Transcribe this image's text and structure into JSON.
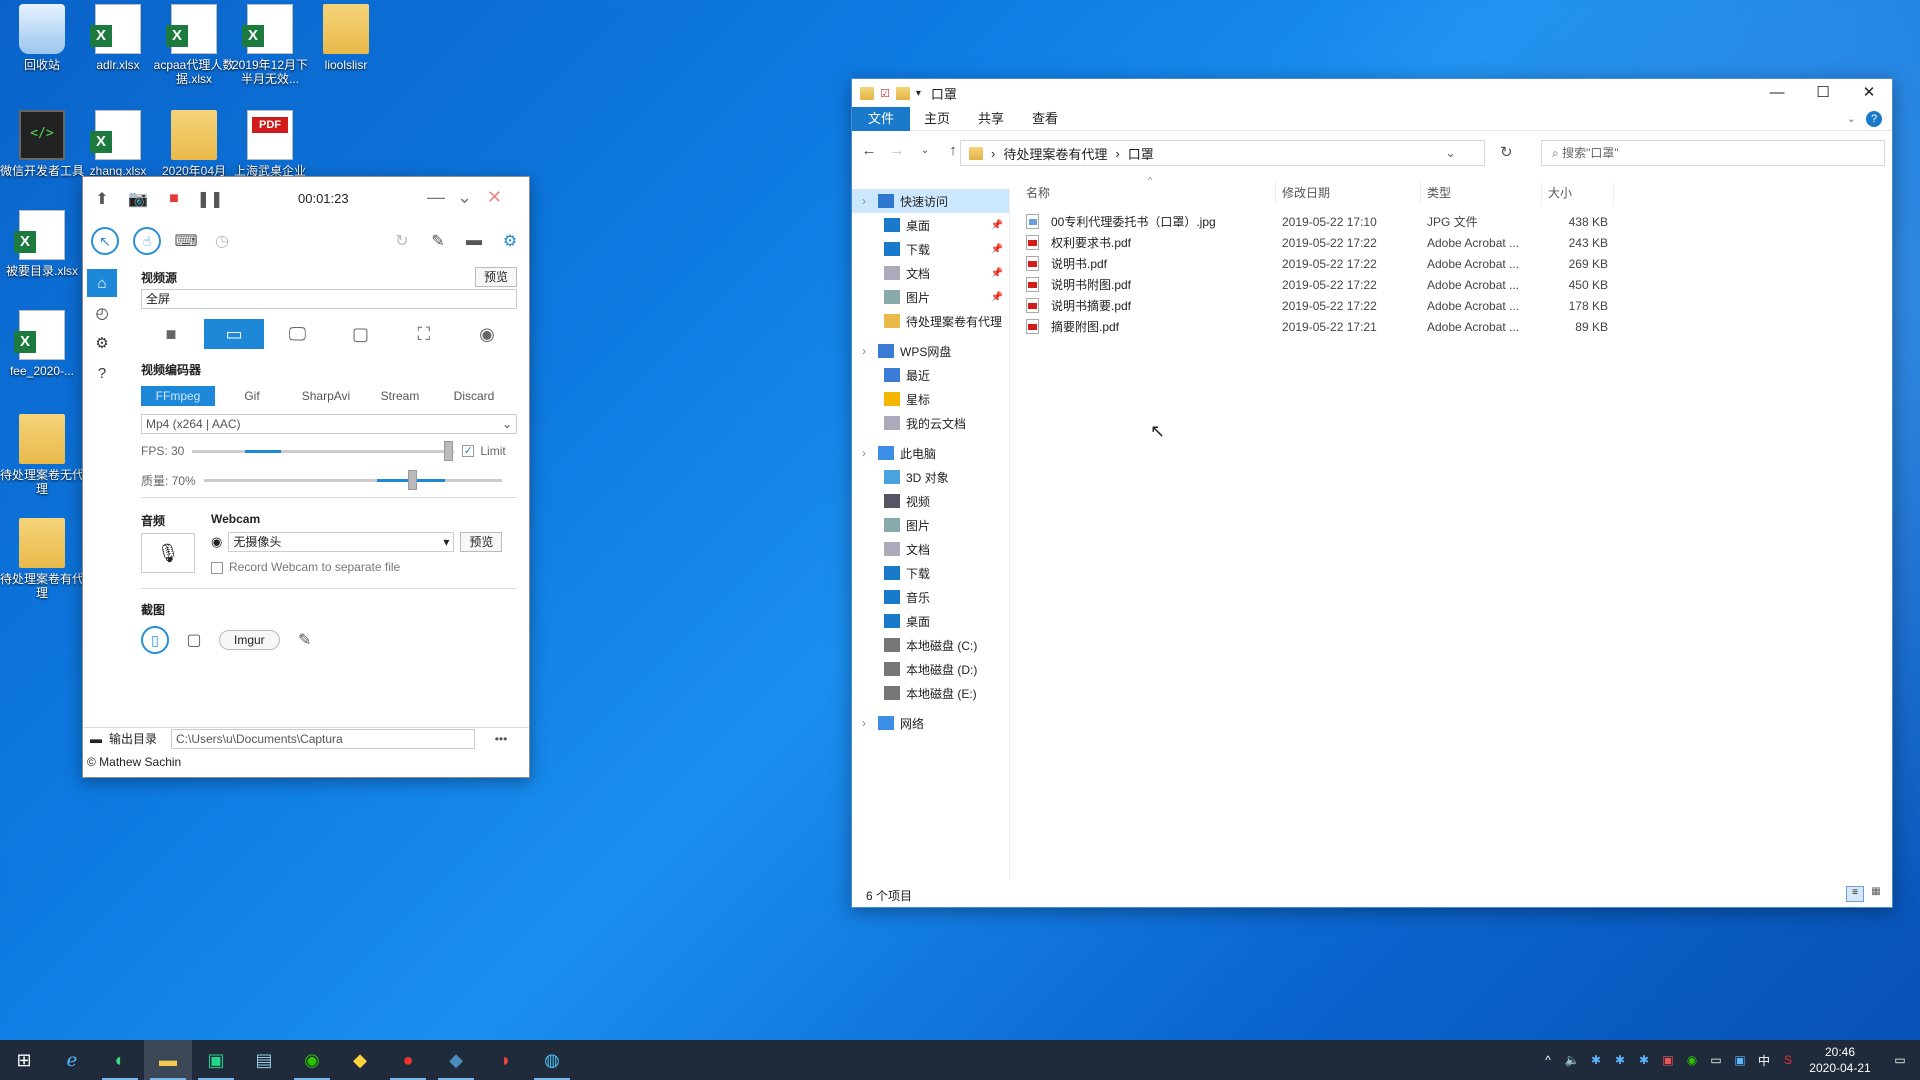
{
  "desktop": {
    "icons": [
      {
        "label": "回收站",
        "type": "recycle-bin"
      },
      {
        "label": "adlr.xlsx",
        "type": "excel"
      },
      {
        "label": "acpaa代理人数据.xlsx",
        "type": "excel"
      },
      {
        "label": "2019年12月下半月无效...",
        "type": "excel"
      },
      {
        "label": "lioolslisr",
        "type": "folder"
      },
      {
        "label": "微信开发者工具",
        "type": "terminal"
      },
      {
        "label": "zhang.xlsx",
        "type": "excel"
      },
      {
        "label": "2020年04月",
        "type": "folder"
      },
      {
        "label": "上海武桌企业",
        "type": "pdf"
      },
      {
        "label": "被要目录.xlsx",
        "type": "excel"
      },
      {
        "label": "fee_2020-...",
        "type": "excel"
      },
      {
        "label": "待处理案卷无代理",
        "type": "folder"
      },
      {
        "label": "待处理案卷有代理",
        "type": "folder"
      }
    ]
  },
  "captura": {
    "timer": "00:01:23",
    "video_source_label": "视频源",
    "preview_label": "预览",
    "source_value": "全屏",
    "encoder_label": "视频编码器",
    "encoders": [
      "FFmpeg",
      "Gif",
      "SharpAvi",
      "Stream",
      "Discard"
    ],
    "encoder_selected": "FFmpeg",
    "format": "Mp4 (x264 | AAC)",
    "fps_label": "FPS: 30",
    "fps_value": 30,
    "limit_label": "Limit",
    "limit_checked": true,
    "quality_label": "质量: 70%",
    "quality_value": 70,
    "audio_label": "音频",
    "webcam_label": "Webcam",
    "webcam_value": "无摄像头",
    "webcam_preview": "预览",
    "webcam_separate": "Record Webcam to separate file",
    "screenshot_label": "截图",
    "imgur_label": "Imgur",
    "output_label": "输出目录",
    "output_path": "C:\\Users\\u\\Documents\\Captura",
    "more_label": "•••",
    "credit": "© Mathew Sachin",
    "accent": "#1e88d8"
  },
  "explorer": {
    "title": "口罩",
    "ribbon_tabs": [
      "文件",
      "主页",
      "共享",
      "查看"
    ],
    "breadcrumb": [
      "待处理案卷有代理",
      "口罩"
    ],
    "search_placeholder": "搜索\"口罩\"",
    "columns": [
      "名称",
      "修改日期",
      "类型",
      "大小"
    ],
    "files": [
      {
        "name": "00专利代理委托书（口罩）.jpg",
        "date": "2019-05-22 17:10",
        "type": "JPG 文件",
        "size": "438 KB",
        "kind": "jpg"
      },
      {
        "name": "权利要求书.pdf",
        "date": "2019-05-22 17:22",
        "type": "Adobe Acrobat ...",
        "size": "243 KB",
        "kind": "pdf"
      },
      {
        "name": "说明书.pdf",
        "date": "2019-05-22 17:22",
        "type": "Adobe Acrobat ...",
        "size": "269 KB",
        "kind": "pdf"
      },
      {
        "name": "说明书附图.pdf",
        "date": "2019-05-22 17:22",
        "type": "Adobe Acrobat ...",
        "size": "450 KB",
        "kind": "pdf"
      },
      {
        "name": "说明书摘要.pdf",
        "date": "2019-05-22 17:22",
        "type": "Adobe Acrobat ...",
        "size": "178 KB",
        "kind": "pdf"
      },
      {
        "name": "摘要附图.pdf",
        "date": "2019-05-22 17:21",
        "type": "Adobe Acrobat ...",
        "size": "89 KB",
        "kind": "pdf"
      }
    ],
    "nav": [
      {
        "label": "快速访问",
        "level": 0,
        "icon": "star",
        "selected": true
      },
      {
        "label": "桌面",
        "level": 1,
        "icon": "desktop",
        "pinned": true
      },
      {
        "label": "下载",
        "level": 1,
        "icon": "download",
        "pinned": true
      },
      {
        "label": "文档",
        "level": 1,
        "icon": "doc",
        "pinned": true
      },
      {
        "label": "图片",
        "level": 1,
        "icon": "pic",
        "pinned": true
      },
      {
        "label": "待处理案卷有代理",
        "level": 1,
        "icon": "folder"
      },
      {
        "label": "",
        "level": 0,
        "icon": "gap"
      },
      {
        "label": "WPS网盘",
        "level": 0,
        "icon": "cloud"
      },
      {
        "label": "最近",
        "level": 1,
        "icon": "clock"
      },
      {
        "label": "星标",
        "level": 1,
        "icon": "starred"
      },
      {
        "label": "我的云文档",
        "level": 1,
        "icon": "doc"
      },
      {
        "label": "",
        "level": 0,
        "icon": "gap"
      },
      {
        "label": "此电脑",
        "level": 0,
        "icon": "pc"
      },
      {
        "label": "3D 对象",
        "level": 1,
        "icon": "cube"
      },
      {
        "label": "视频",
        "level": 1,
        "icon": "video"
      },
      {
        "label": "图片",
        "level": 1,
        "icon": "pic"
      },
      {
        "label": "文档",
        "level": 1,
        "icon": "doc"
      },
      {
        "label": "下载",
        "level": 1,
        "icon": "download"
      },
      {
        "label": "音乐",
        "level": 1,
        "icon": "music"
      },
      {
        "label": "桌面",
        "level": 1,
        "icon": "desktop"
      },
      {
        "label": "本地磁盘 (C:)",
        "level": 1,
        "icon": "drive"
      },
      {
        "label": "本地磁盘 (D:)",
        "level": 1,
        "icon": "drive"
      },
      {
        "label": "本地磁盘 (E:)",
        "level": 1,
        "icon": "drive"
      },
      {
        "label": "",
        "level": 0,
        "icon": "gap"
      },
      {
        "label": "网络",
        "level": 0,
        "icon": "network"
      }
    ],
    "status": "6 个项目"
  },
  "taskbar": {
    "apps": [
      "start",
      "ie",
      "edge",
      "explorer",
      "pycharm",
      "notepad",
      "wechat",
      "python",
      "recorder",
      "python2",
      "captura",
      "app"
    ],
    "clock_time": "20:46",
    "clock_date": "2020-04-21",
    "ime": "中"
  }
}
